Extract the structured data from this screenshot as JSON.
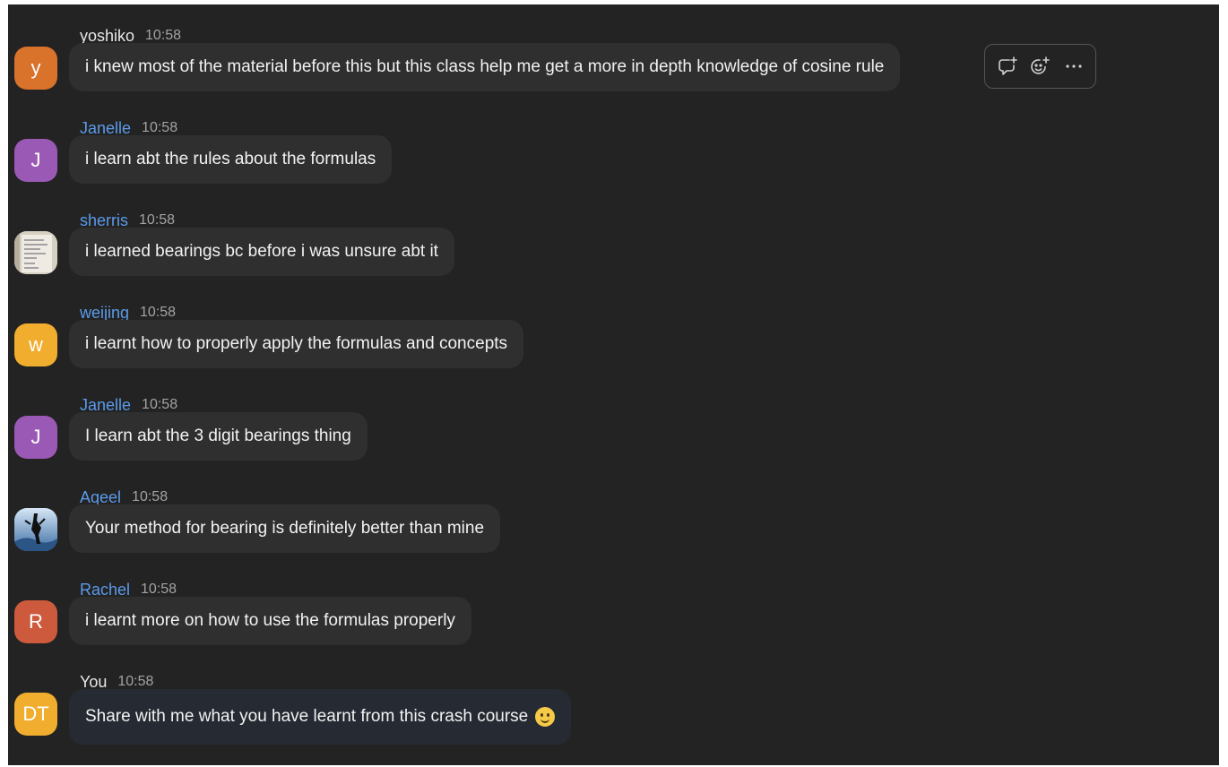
{
  "messages": [
    {
      "name": "yoshiko",
      "time": "10:58",
      "text": "i knew most of the material before this but this class help me get a more in depth knowledge of cosine rule",
      "avatar_letter": "y",
      "avatar_color": "#d9722b",
      "name_color": "#e6e6e6"
    },
    {
      "name": "Janelle",
      "time": "10:58",
      "text": "i learn abt the rules about the formulas",
      "avatar_letter": "J",
      "avatar_color": "#9b59b6",
      "name_color": "#5b9bea"
    },
    {
      "name": "sherris",
      "time": "10:58",
      "text": "i learned bearings bc before i was unsure abt it",
      "avatar_letter": "",
      "avatar_color": "#d8d2c4",
      "name_color": "#5b9bea"
    },
    {
      "name": "weijing",
      "time": "10:58",
      "text": "i learnt how to properly apply the formulas and concepts",
      "avatar_letter": "w",
      "avatar_color": "#f0ad2e",
      "name_color": "#5b9bea"
    },
    {
      "name": "Janelle",
      "time": "10:58",
      "text": "I learn abt the 3 digit bearings thing",
      "avatar_letter": "J",
      "avatar_color": "#9b59b6",
      "name_color": "#5b9bea"
    },
    {
      "name": "Aqeel",
      "time": "10:58",
      "text": "Your method for bearing is definitely better than mine",
      "avatar_letter": "",
      "avatar_color": "#4a7fb5",
      "name_color": "#5b9bea"
    },
    {
      "name": "Rachel",
      "time": "10:58",
      "text": "i learnt more on how to use the formulas properly",
      "avatar_letter": "R",
      "avatar_color": "#cd5a3c",
      "name_color": "#5b9bea"
    },
    {
      "name": "You",
      "time": "10:58",
      "text": "Share with me what you have learnt from this crash course",
      "avatar_letter": "DT",
      "avatar_color": "#f0ad2e",
      "name_color": "#e6e6e6"
    }
  ],
  "message_actions": {
    "icons": [
      "reply-in-thread-icon",
      "add-reaction-icon",
      "more-options-icon"
    ]
  }
}
